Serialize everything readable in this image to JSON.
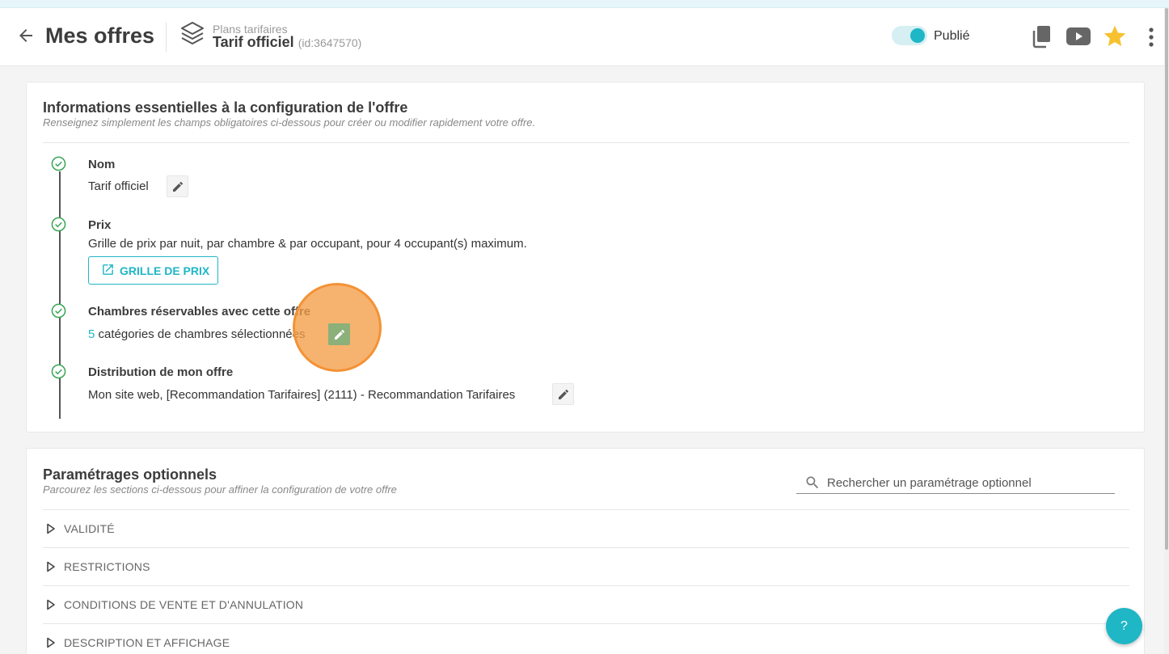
{
  "header": {
    "title": "Mes offres",
    "breadcrumb_label": "Plans tarifaires",
    "offer_name": "Tarif officiel",
    "offer_id": "(id:3647570)",
    "publish_label": "Publié",
    "published": true
  },
  "essentials": {
    "title": "Informations essentielles à la configuration de l'offre",
    "subtitle": "Renseignez simplement les champs obligatoires ci-dessous pour créer ou modifier rapidement votre offre.",
    "steps": [
      {
        "label": "Nom",
        "text": "Tarif officiel"
      },
      {
        "label": "Prix",
        "text": "Grille de prix par nuit, par chambre & par occupant, pour 4 occupant(s) maximum.",
        "button": "GRILLE DE PRIX"
      },
      {
        "label": "Chambres réservables avec cette offre",
        "count": "5",
        "text": " catégories de chambres sélectionnées"
      },
      {
        "label": "Distribution de mon offre",
        "text": "Mon site web, [Recommandation Tarifaires] (2111) - Recommandation Tarifaires"
      }
    ]
  },
  "optional": {
    "title": "Paramétrages optionnels",
    "subtitle": "Parcourez les sections ci-dessous pour affiner la configuration de votre offre",
    "search_placeholder": "Rechercher un paramétrage optionnel",
    "sections": [
      "VALIDITÉ",
      "RESTRICTIONS",
      "CONDITIONS DE VENTE ET D'ANNULATION",
      "DESCRIPTION ET AFFICHAGE"
    ]
  },
  "help_label": "?",
  "colors": {
    "accent": "#1fb6c6",
    "check": "#3aa556",
    "star": "#f7c12f",
    "highlight": "#f39236"
  }
}
